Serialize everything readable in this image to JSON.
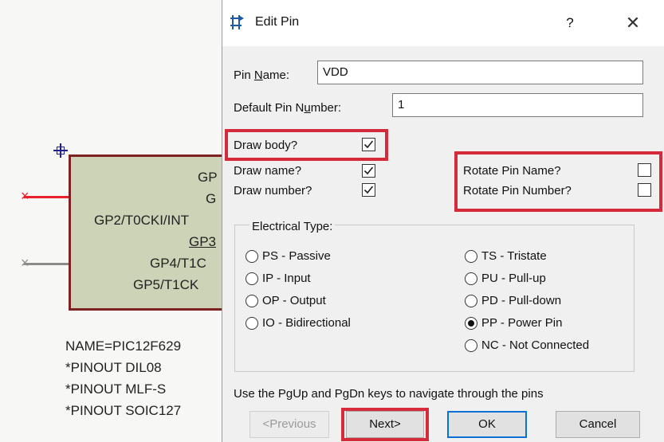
{
  "schematic": {
    "pin_labels": [
      "GP",
      "G",
      "GP2/T0CKI/INT",
      "GP3",
      "GP4/T1C",
      "GP5/T1CK"
    ],
    "properties": [
      "NAME=PIC12F629",
      "*PINOUT DIL08",
      "*PINOUT MLF-S",
      "*PINOUT SOIC127"
    ],
    "colors": {
      "body_fill": "#cdd3b6",
      "body_border": "#7d2222",
      "pin_active": "#e8212b",
      "pin_inactive": "#8b8b8b"
    }
  },
  "dialog": {
    "title": "Edit Pin",
    "title_icon": "pin-icon",
    "help_label": "?",
    "close_label": "✕",
    "pin_name_label_pre": "Pin ",
    "pin_name_label_u": "N",
    "pin_name_label_post": "ame:",
    "pin_name_value": "VDD",
    "default_number_label_pre": "Default Pin N",
    "default_number_label_u": "u",
    "default_number_label_post": "mber:",
    "default_number_value": "1",
    "options": {
      "draw_body": {
        "label": "Draw body?",
        "checked": true
      },
      "draw_name": {
        "label": "Draw name?",
        "checked": true
      },
      "draw_number": {
        "label": "Draw number?",
        "checked": true
      },
      "rotate_name": {
        "label": "Rotate Pin Name?",
        "checked": false
      },
      "rotate_number": {
        "label": "Rotate Pin Number?",
        "checked": false
      }
    },
    "electrical_type": {
      "title": "Electrical Type:",
      "left": [
        "PS - Passive",
        "IP - Input",
        "OP - Output",
        "IO - Bidirectional"
      ],
      "right": [
        "TS - Tristate",
        "PU - Pull-up",
        "PD - Pull-down",
        "PP - Power Pin",
        "NC - Not Connected"
      ],
      "selected": "PP - Power Pin"
    },
    "hint": "Use the PgUp and PgDn keys to navigate through the pins",
    "buttons": {
      "previous": "<Previous",
      "next": "Next>",
      "ok": "OK",
      "cancel": "Cancel"
    },
    "highlight_color": "#d42a3a"
  }
}
